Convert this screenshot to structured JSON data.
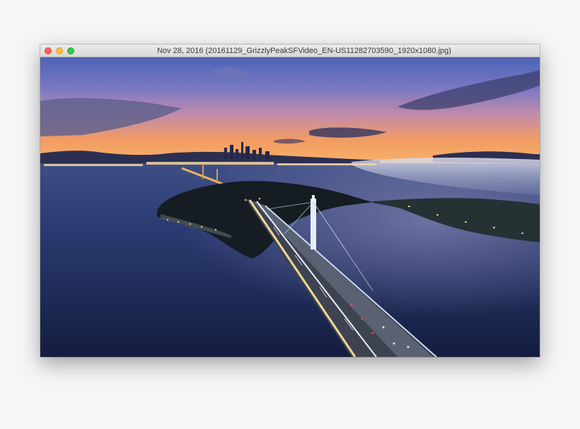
{
  "window": {
    "title": "Nov 28, 2016 (20161129_GrizzlyPeakSFVideo_EN-US11282703590_1920x1080.jpg)"
  },
  "controls": {
    "close": "close-button",
    "minimize": "minimize-button",
    "zoom": "zoom-button"
  },
  "colors": {
    "close": "#fc605c",
    "minimize": "#fdbc40",
    "zoom": "#34c84a",
    "sky_top": "#4f63b8",
    "sky_horizon": "#f7a75b",
    "water": "#1d2b5c"
  }
}
